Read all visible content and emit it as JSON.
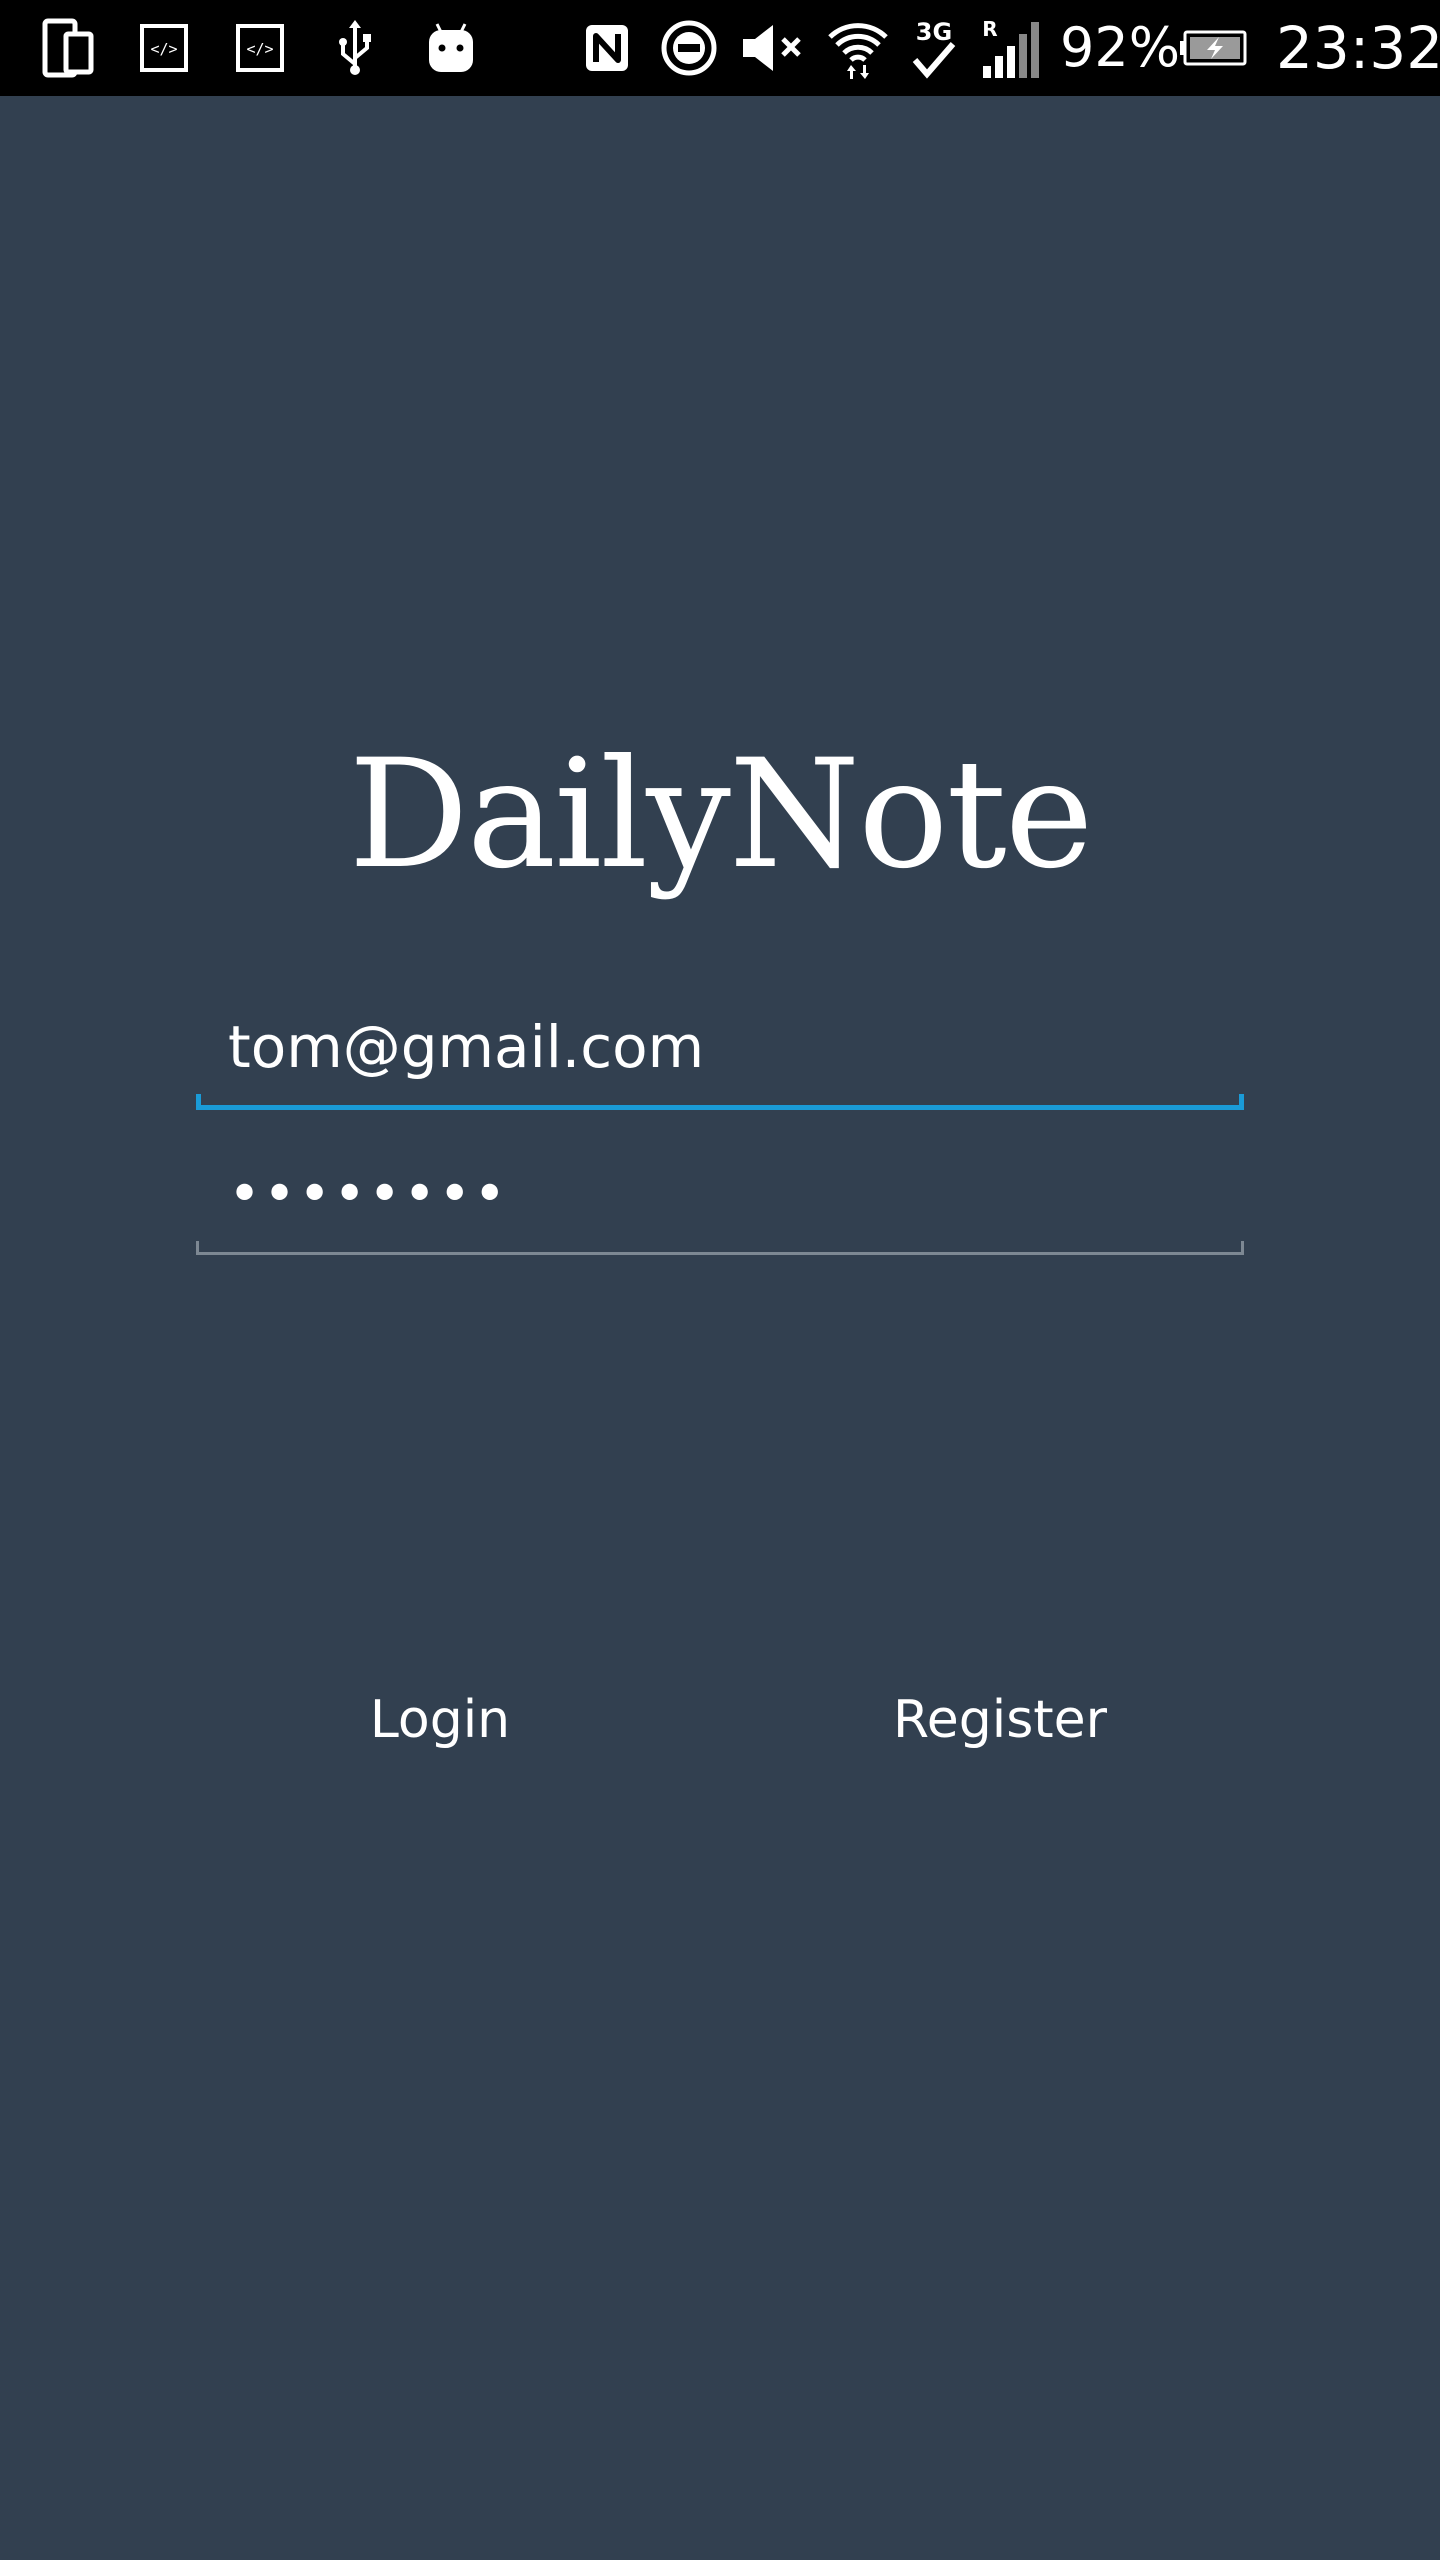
{
  "status_bar": {
    "battery_percent": "92%",
    "time": "23:32",
    "network_type": "3G",
    "roaming": "R",
    "icons": [
      "phone-tablet-icon",
      "code-box-icon",
      "code-box-icon",
      "usb-icon",
      "android-icon",
      "nfc-icon",
      "do-not-disturb-icon",
      "mute-icon",
      "wifi-icon",
      "3g-data-icon",
      "signal-icon",
      "battery-charging-icon"
    ]
  },
  "app": {
    "title": "DailyNote"
  },
  "form": {
    "email_value": "tom@gmail.com",
    "password_value": "••••••••"
  },
  "actions": {
    "login_label": "Login",
    "register_label": "Register"
  },
  "colors": {
    "background": "#324050",
    "accent": "#1a9bd7",
    "inactive_line": "#7d8893",
    "status_bar": "#000000"
  }
}
